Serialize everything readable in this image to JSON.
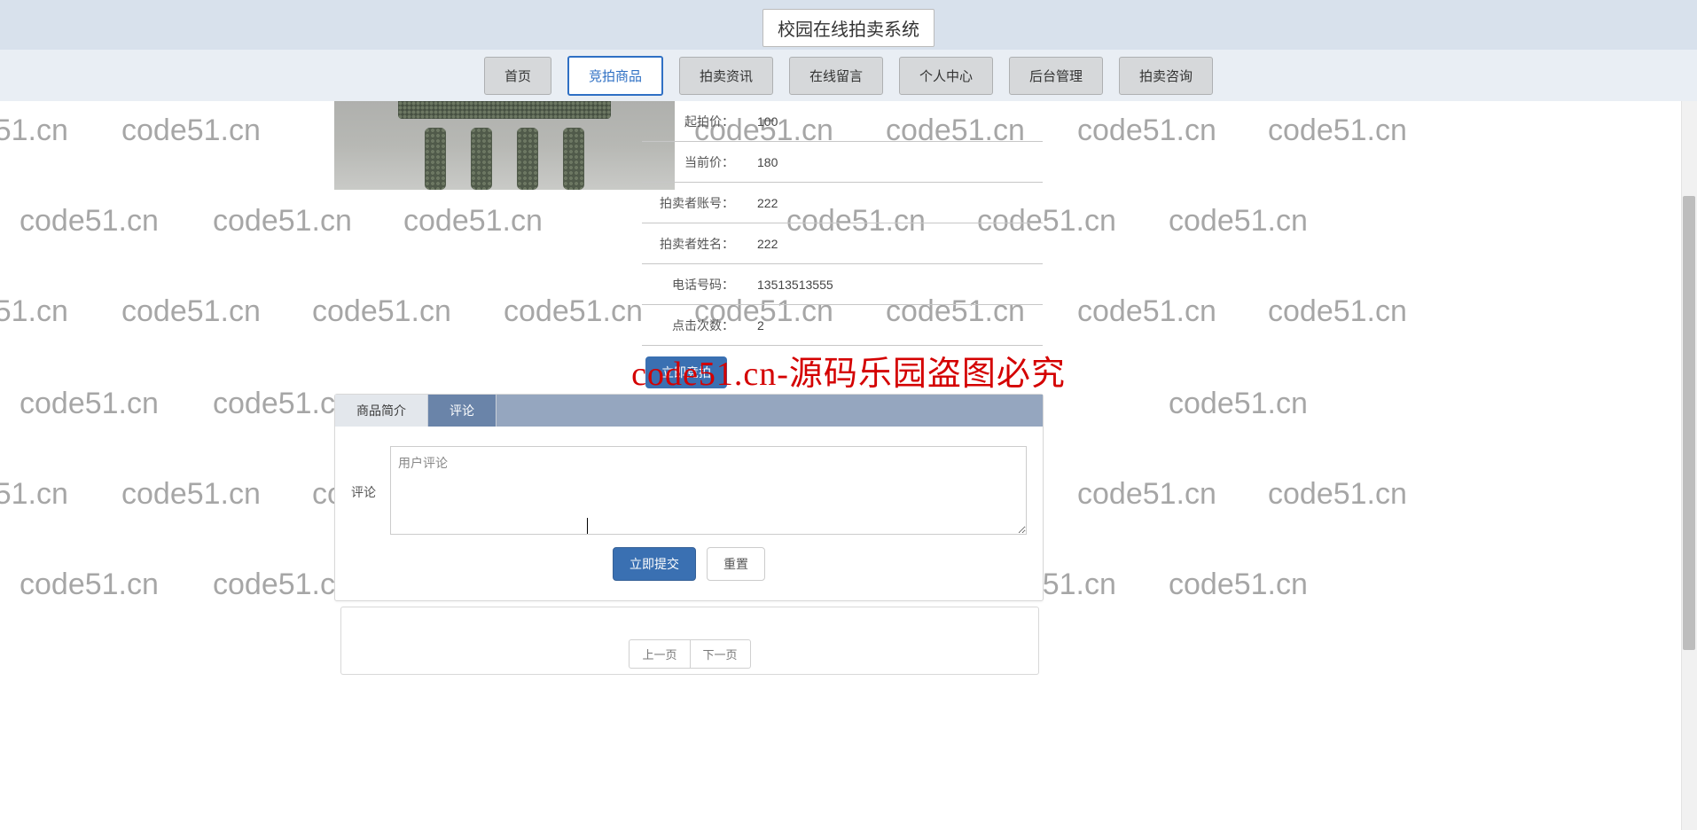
{
  "app_title": "校园在线拍卖系统",
  "watermark_text": "code51.cn",
  "brand_watermark": "code51.cn-源码乐园盗图必究",
  "nav": [
    {
      "label": "首页",
      "active": false
    },
    {
      "label": "竞拍商品",
      "active": true
    },
    {
      "label": "拍卖资讯",
      "active": false
    },
    {
      "label": "在线留言",
      "active": false
    },
    {
      "label": "个人中心",
      "active": false
    },
    {
      "label": "后台管理",
      "active": false
    },
    {
      "label": "拍卖咨询",
      "active": false
    }
  ],
  "details": {
    "start_price_label": "起拍价：",
    "start_price_value": "100",
    "current_price_label": "当前价：",
    "current_price_value": "180",
    "seller_acct_label": "拍卖者账号：",
    "seller_acct_value": "222",
    "seller_name_label": "拍卖者姓名：",
    "seller_name_value": "222",
    "phone_label": "电话号码：",
    "phone_value": "13513513555",
    "clicks_label": "点击次数：",
    "clicks_value": "2",
    "bid_button": "立即竞拍"
  },
  "tabs": {
    "intro_label": "商品简介",
    "comments_label": "评论"
  },
  "comment_form": {
    "row_label": "评论",
    "placeholder": "用户评论",
    "submit_label": "立即提交",
    "reset_label": "重置"
  },
  "pager": {
    "prev_label": "上一页",
    "next_label": "下一页"
  }
}
